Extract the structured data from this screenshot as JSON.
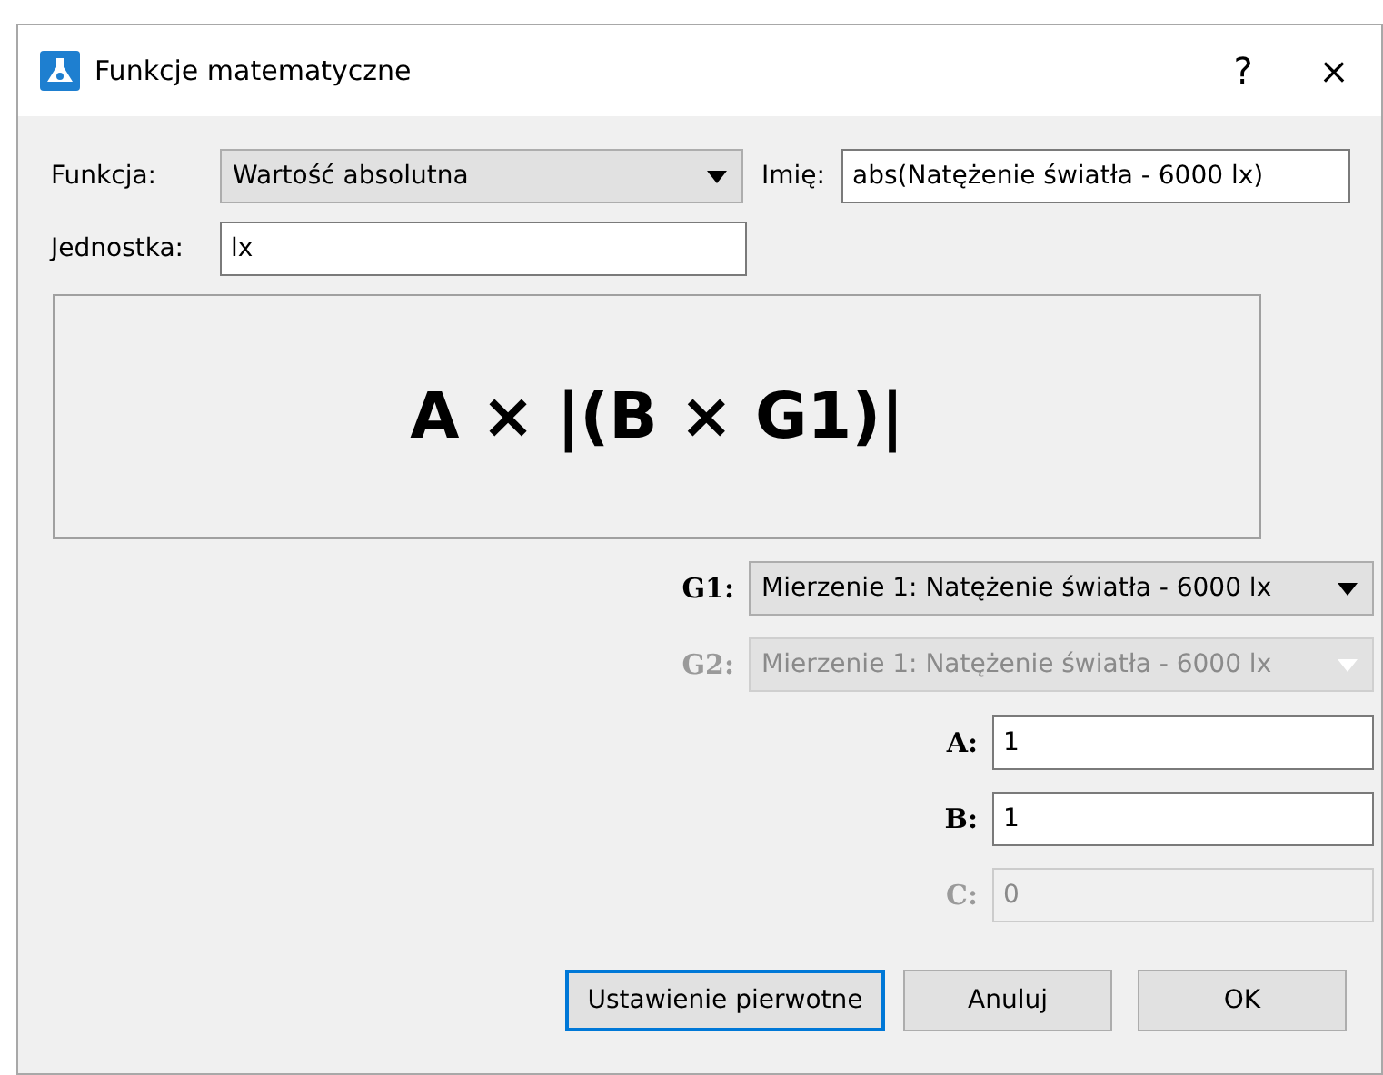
{
  "window": {
    "title": "Funkcje matematyczne",
    "help": "?",
    "close": "×"
  },
  "function": {
    "label": "Funkcja:",
    "value": "Wartość absolutna"
  },
  "name": {
    "label": "Imię:",
    "value": "abs(Natężenie światła - 6000 lx)"
  },
  "unit": {
    "label": "Jednostka:",
    "value": "lx"
  },
  "formula": "A × |(B × G1)|",
  "sources": [
    {
      "label": "G1:",
      "value": "Mierzenie 1: Natężenie światła - 6000 lx",
      "disabled": false
    },
    {
      "label": "G2:",
      "value": "Mierzenie 1: Natężenie światła - 6000 lx",
      "disabled": true
    }
  ],
  "params": [
    {
      "label": "A:",
      "value": "1",
      "disabled": false
    },
    {
      "label": "B:",
      "value": "1",
      "disabled": false
    },
    {
      "label": "C:",
      "value": "0",
      "disabled": true
    }
  ],
  "buttons": [
    {
      "label": "Ustawienie pierwotne",
      "focused": true
    },
    {
      "label": "Anuluj",
      "focused": false
    },
    {
      "label": "OK",
      "focused": false
    }
  ]
}
